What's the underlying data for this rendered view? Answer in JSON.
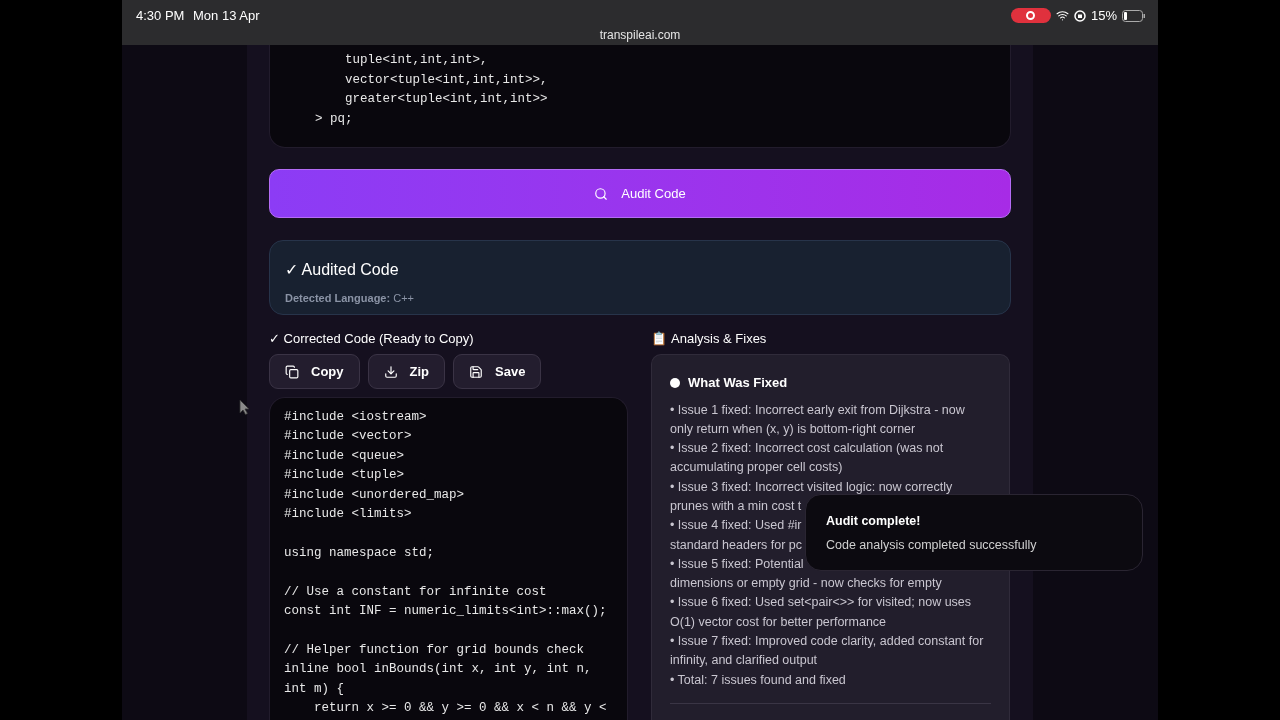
{
  "status_bar": {
    "time": "4:30 PM",
    "date": "Mon 13 Apr",
    "url": "transpileai.com",
    "battery": "15%"
  },
  "top_code": [
    "    tuple<int,int,int>,",
    "    vector<tuple<int,int,int>>,",
    "    greater<tuple<int,int,int>>",
    "> pq;"
  ],
  "audit_button": {
    "label": "Audit Code"
  },
  "result": {
    "title": "✓ Audited Code",
    "language_label": "Detected Language:",
    "language": "C++"
  },
  "corrected": {
    "title": "✓ Corrected Code (Ready to Copy)",
    "buttons": [
      {
        "kind": "copy",
        "label": "Copy"
      },
      {
        "kind": "zip",
        "label": "Zip"
      },
      {
        "kind": "save",
        "label": "Save"
      }
    ],
    "code": [
      [
        "#include <iostream>",
        "#include <vector>",
        "#include <queue>",
        "#include <tuple>",
        "#include <unordered_map>",
        "#include <limits>"
      ],
      [
        "using namespace std;"
      ],
      [
        "// Use a constant for infinite cost",
        "const int INF = numeric_limits<int>::max();"
      ],
      [
        "// Helper function for grid bounds check",
        "inline bool inBounds(int x, int y, int n,",
        "int m) {",
        "    return x >= 0 && y >= 0 && x < n && y <"
      ]
    ]
  },
  "analysis": {
    "icon": "📋",
    "title": "Analysis & Fixes",
    "section": "What Was Fixed",
    "lines": [
      "• Issue 1 fixed: Incorrect early exit from Dijkstra - now",
      "only return when (x, y) is bottom-right corner",
      "• Issue 2 fixed: Incorrect cost calculation (was not",
      "accumulating proper cell costs)",
      "• Issue 3 fixed: Incorrect visited logic: now correctly",
      "prunes with a min cost t",
      "• Issue 4 fixed: Used #ir",
      "standard headers for pc",
      "• Issue 5 fixed: Potential",
      "dimensions or empty grid - now checks for empty",
      "• Issue 6 fixed: Used set<pair<>> for visited; now uses",
      "O(1) vector cost for better performance",
      "• Issue 7 fixed: Improved code clarity, added constant for",
      "infinity, and clarified output",
      "• Total: 7 issues found and fixed"
    ]
  },
  "toast": {
    "title": "Audit complete!",
    "message": "Code analysis completed successfully"
  }
}
